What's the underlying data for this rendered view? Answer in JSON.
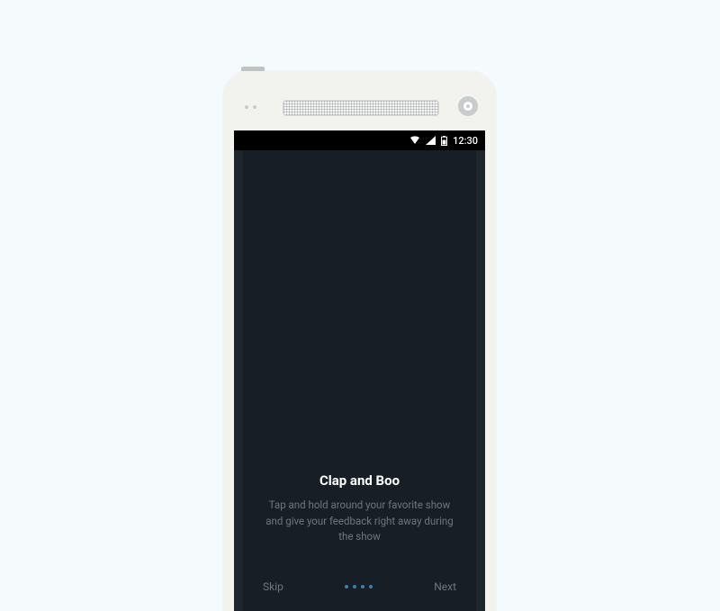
{
  "status_bar": {
    "time": "12:30"
  },
  "onboarding": {
    "title": "Clap and Boo",
    "subtitle": "Tap and hold around your favorite show and give your feedback right away during the show"
  },
  "nav": {
    "skip": "Skip",
    "next": "Next"
  },
  "pager": {
    "count": 4,
    "active_index": 0
  }
}
